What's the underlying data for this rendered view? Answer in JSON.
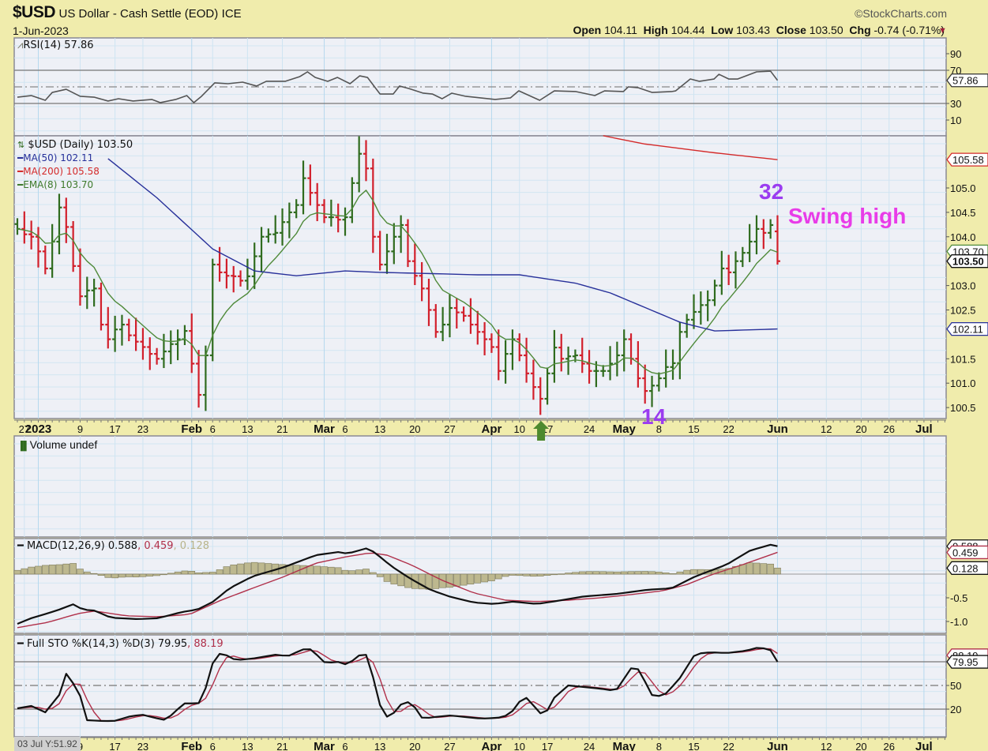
{
  "header": {
    "symbol": "$USD",
    "name": "US Dollar - Cash Settle (EOD)",
    "exchange": "ICE",
    "date": "1-Jun-2023",
    "brand": "©StockCharts.com",
    "open_label": "Open",
    "open": "104.11",
    "high_label": "High",
    "high": "104.44",
    "low_label": "Low",
    "low": "103.43",
    "close_label": "Close",
    "close": "103.50",
    "chg_label": "Chg",
    "chg": "-0.74 (-0.71%)",
    "chg_icon": "down-triangle-icon"
  },
  "legends": {
    "rsi": "RSI(14) 57.86",
    "price": "$USD (Daily) 103.50",
    "ma50": "MA(50) 102.11",
    "ma200": "MA(200) 105.58",
    "ema8": "EMA(8) 103.70",
    "volume": "Volume undef",
    "macd_main": "MACD(12,26,9) 0.588",
    "macd_signal": ", 0.459",
    "macd_hist": ", 0.128",
    "sto_main": "Full STO %K(14,3) %D(3) 79.95",
    "sto_d": ", 88.19"
  },
  "annotations": {
    "count_high": "32",
    "swing_high": "Swing high",
    "count_low": "14"
  },
  "footer": {
    "readout": "03 Jul Y:51.92"
  },
  "colors": {
    "up": "#2f6b1e",
    "down": "#d21f2b",
    "ma50": "#27309a",
    "ma200": "#d42a2a",
    "ema8": "#4f8a3a",
    "macd": "#111111",
    "signal": "#b0304a",
    "hist": "#bdb88f",
    "annot_purple": "#9b3cf0",
    "annot_magenta": "#e83ce8",
    "arrow": "#4d8a2e"
  },
  "chart_data": {
    "type": "bar",
    "title": "$USD US Dollar - Cash Settle (EOD) ICE",
    "last_bar": {
      "open": 104.11,
      "high": 104.44,
      "low": 103.43,
      "close": 103.5
    },
    "close": [
      104.16,
      104.05,
      104.0,
      103.7,
      103.35,
      103.9,
      104.6,
      104.2,
      103.4,
      102.78,
      102.9,
      102.94,
      102.2,
      101.9,
      102.1,
      102.2,
      101.98,
      101.85,
      101.74,
      101.6,
      101.5,
      101.65,
      101.8,
      101.9,
      102.07,
      101.4,
      100.76,
      101.57,
      103.43,
      103.27,
      103.2,
      103.19,
      103.1,
      103.19,
      103.6,
      104.0,
      104.05,
      104.08,
      104.3,
      104.5,
      104.65,
      105.2,
      104.9,
      104.65,
      104.4,
      104.4,
      104.35,
      104.4,
      105.1,
      105.7,
      105.4,
      104.0,
      103.43,
      103.7,
      104.0,
      104.24,
      103.5,
      103.2,
      102.94,
      102.5,
      102.05,
      102.2,
      102.54,
      102.45,
      102.38,
      102.2,
      102.05,
      101.9,
      101.74,
      101.25,
      101.6,
      101.9,
      101.57,
      101.2,
      100.92,
      100.68,
      101.2,
      101.73,
      101.5,
      101.55,
      101.57,
      101.4,
      101.25,
      101.25,
      101.25,
      101.4,
      101.57,
      101.9,
      101.5,
      101.1,
      100.84,
      100.95,
      101.1,
      101.33,
      101.41,
      102.05,
      102.3,
      102.46,
      102.6,
      102.7,
      103.0,
      103.35,
      103.27,
      103.5,
      103.67,
      103.9,
      104.16,
      104.08,
      104.24,
      103.5
    ],
    "ma50": [
      [
        13,
        105.6
      ],
      [
        20,
        104.8
      ],
      [
        28,
        103.75
      ],
      [
        34,
        103.3
      ],
      [
        40,
        103.2
      ],
      [
        47,
        103.3
      ],
      [
        52,
        103.27
      ],
      [
        58,
        103.25
      ],
      [
        66,
        103.22
      ],
      [
        72,
        103.22
      ],
      [
        80,
        103.05
      ],
      [
        85,
        102.85
      ],
      [
        90,
        102.55
      ],
      [
        95,
        102.25
      ],
      [
        100,
        102.07
      ],
      [
        109,
        102.11
      ]
    ],
    "ma200": [
      [
        84,
        106.07
      ],
      [
        90,
        105.9
      ],
      [
        100,
        105.72
      ],
      [
        109,
        105.58
      ]
    ],
    "ema_period": 8,
    "price_axis": {
      "ticks": [
        "105.0",
        "104.5",
        "104.0",
        "103.0",
        "102.5",
        "101.5",
        "101.0",
        "100.5"
      ],
      "range": [
        100.3,
        106.07
      ]
    },
    "price_tags": [
      {
        "value": 105.58,
        "label": "105.58",
        "color": "#d42a2a"
      },
      {
        "value": 103.7,
        "label": "103.70",
        "color": "#4f8a3a"
      },
      {
        "value": 103.5,
        "label": "103.50",
        "color": "#111111",
        "bold": true
      },
      {
        "value": 102.11,
        "label": "102.11",
        "color": "#27309a"
      }
    ],
    "date_axis": [
      {
        "bar": 1,
        "label": "27"
      },
      {
        "bar": 3,
        "label": "2023",
        "bold": true
      },
      {
        "bar": 9,
        "label": "9"
      },
      {
        "bar": 14,
        "label": "17"
      },
      {
        "bar": 18,
        "label": "23"
      },
      {
        "bar": 25,
        "label": "Feb",
        "bold": true
      },
      {
        "bar": 28,
        "label": "6"
      },
      {
        "bar": 33,
        "label": "13"
      },
      {
        "bar": 38,
        "label": "21"
      },
      {
        "bar": 44,
        "label": "Mar",
        "bold": true
      },
      {
        "bar": 47,
        "label": "6"
      },
      {
        "bar": 52,
        "label": "13"
      },
      {
        "bar": 57,
        "label": "20"
      },
      {
        "bar": 62,
        "label": "27"
      },
      {
        "bar": 68,
        "label": "Apr",
        "bold": true
      },
      {
        "bar": 72,
        "label": "10"
      },
      {
        "bar": 76,
        "label": "17"
      },
      {
        "bar": 82,
        "label": "24"
      },
      {
        "bar": 87,
        "label": "May",
        "bold": true
      },
      {
        "bar": 92,
        "label": "8"
      },
      {
        "bar": 97,
        "label": "15"
      },
      {
        "bar": 102,
        "label": "22"
      },
      {
        "bar": 109,
        "label": "Jun",
        "bold": true
      },
      {
        "bar": 116,
        "label": "12"
      },
      {
        "bar": 121,
        "label": "20"
      },
      {
        "bar": 125,
        "label": "26"
      },
      {
        "bar": 130,
        "label": "Jul",
        "bold": true
      }
    ],
    "rsi": {
      "points": [
        [
          0,
          37.6
        ],
        [
          2,
          39.5
        ],
        [
          4,
          33.8
        ],
        [
          5,
          43.3
        ],
        [
          7,
          47.1
        ],
        [
          9,
          38.6
        ],
        [
          11,
          37.6
        ],
        [
          13,
          32.9
        ],
        [
          14.5,
          35.7
        ],
        [
          16.6,
          32.9
        ],
        [
          19.3,
          34.8
        ],
        [
          20.5,
          31
        ],
        [
          22.7,
          34.8
        ],
        [
          24.3,
          39.5
        ],
        [
          25.3,
          31
        ],
        [
          26.4,
          38.6
        ],
        [
          28.3,
          54.8
        ],
        [
          30.2,
          53.8
        ],
        [
          32.3,
          55.7
        ],
        [
          34.3,
          51
        ],
        [
          35.7,
          56.7
        ],
        [
          38.4,
          56.7
        ],
        [
          40.5,
          62.4
        ],
        [
          41.6,
          68.1
        ],
        [
          42.7,
          61.4
        ],
        [
          44.5,
          56.7
        ],
        [
          45.9,
          61.4
        ],
        [
          47.7,
          53.8
        ],
        [
          49.1,
          63.3
        ],
        [
          50.2,
          61.4
        ],
        [
          52,
          41.4
        ],
        [
          53.9,
          41.4
        ],
        [
          54.8,
          51
        ],
        [
          56.1,
          48.1
        ],
        [
          58.2,
          42.4
        ],
        [
          59.5,
          41.4
        ],
        [
          60.9,
          35.7
        ],
        [
          62.3,
          42.4
        ],
        [
          64.3,
          38.6
        ],
        [
          66.4,
          36.7
        ],
        [
          68.5,
          34.8
        ],
        [
          70.7,
          36.7
        ],
        [
          71.9,
          45.2
        ],
        [
          74.9,
          33.8
        ],
        [
          77,
          45.2
        ],
        [
          80.1,
          44.3
        ],
        [
          82.8,
          39.5
        ],
        [
          84.2,
          45.2
        ],
        [
          86.9,
          44.3
        ],
        [
          87.6,
          50
        ],
        [
          89,
          49
        ],
        [
          91,
          43.3
        ],
        [
          93.8,
          44.3
        ],
        [
          94.4,
          45.2
        ],
        [
          96.5,
          59.5
        ],
        [
          97.8,
          56.7
        ],
        [
          99.9,
          59.5
        ],
        [
          100.6,
          65.2
        ],
        [
          102,
          59.5
        ],
        [
          103.3,
          59.5
        ],
        [
          106,
          68.1
        ],
        [
          108,
          69
        ],
        [
          109,
          57.86
        ]
      ],
      "ticks": [
        "90",
        "70",
        "30",
        "10"
      ],
      "levels": [
        70,
        50,
        30
      ],
      "tag": "57.86",
      "value": 57.86
    },
    "macd": {
      "macd": [
        [
          0,
          -1.05
        ],
        [
          2,
          -0.93
        ],
        [
          4.3,
          -0.83
        ],
        [
          6.6,
          -0.72
        ],
        [
          7.9,
          -0.63
        ],
        [
          9.4,
          -0.75
        ],
        [
          11.1,
          -0.77
        ],
        [
          13.4,
          -0.92
        ],
        [
          17.3,
          -0.95
        ],
        [
          20.2,
          -0.93
        ],
        [
          23.6,
          -0.8
        ],
        [
          25.8,
          -0.75
        ],
        [
          28.1,
          -0.58
        ],
        [
          30.4,
          -0.3
        ],
        [
          33.7,
          -0.05
        ],
        [
          38.3,
          0.15
        ],
        [
          42.8,
          0.4
        ],
        [
          46.2,
          0.47
        ],
        [
          47.3,
          0.43
        ],
        [
          49,
          0.5
        ],
        [
          50.2,
          0.55
        ],
        [
          51.3,
          0.45
        ],
        [
          53.6,
          0.17
        ],
        [
          56.4,
          -0.1
        ],
        [
          59.2,
          -0.33
        ],
        [
          62.1,
          -0.48
        ],
        [
          65.5,
          -0.6
        ],
        [
          68.3,
          -0.63
        ],
        [
          71.1,
          -0.58
        ],
        [
          74.5,
          -0.63
        ],
        [
          76.8,
          -0.58
        ],
        [
          81.3,
          -0.47
        ],
        [
          85.8,
          -0.42
        ],
        [
          90.4,
          -0.33
        ],
        [
          93.8,
          -0.3
        ],
        [
          97.2,
          -0.05
        ],
        [
          101.7,
          0.2
        ],
        [
          105.1,
          0.5
        ],
        [
          108,
          0.62
        ],
        [
          109,
          0.588
        ]
      ],
      "signal": [
        [
          0,
          -1.13
        ],
        [
          4.3,
          -1.02
        ],
        [
          8.8,
          -0.83
        ],
        [
          11.1,
          -0.78
        ],
        [
          15.6,
          -0.88
        ],
        [
          20.2,
          -0.9
        ],
        [
          24.7,
          -0.85
        ],
        [
          29.2,
          -0.55
        ],
        [
          33.7,
          -0.3
        ],
        [
          38.3,
          -0.05
        ],
        [
          42.8,
          0.23
        ],
        [
          47.3,
          0.37
        ],
        [
          50.7,
          0.45
        ],
        [
          53,
          0.4
        ],
        [
          56.4,
          0.2
        ],
        [
          60.9,
          -0.13
        ],
        [
          65.5,
          -0.4
        ],
        [
          70,
          -0.55
        ],
        [
          74.5,
          -0.58
        ],
        [
          79,
          -0.55
        ],
        [
          83.6,
          -0.5
        ],
        [
          88.1,
          -0.43
        ],
        [
          92.6,
          -0.35
        ],
        [
          96,
          -0.22
        ],
        [
          99.4,
          -0.02
        ],
        [
          104,
          0.2
        ],
        [
          109,
          0.459
        ]
      ],
      "ticks": [
        "-0.5",
        "-1.0"
      ],
      "tags": [
        {
          "value": 0.588,
          "label": "0.588",
          "color": "#111111"
        },
        {
          "value": 0.459,
          "label": "0.459",
          "color": "#b0304a"
        },
        {
          "value": 0.128,
          "label": "0.128",
          "color": "#111111"
        }
      ]
    },
    "stochastic": {
      "k": [
        [
          0,
          21
        ],
        [
          2,
          24
        ],
        [
          4,
          16
        ],
        [
          6,
          38
        ],
        [
          6.9,
          66
        ],
        [
          8.8,
          43
        ],
        [
          10,
          6
        ],
        [
          12.2,
          5
        ],
        [
          13.9,
          5
        ],
        [
          16.2,
          11
        ],
        [
          17.9,
          13
        ],
        [
          20.2,
          8
        ],
        [
          21.3,
          6
        ],
        [
          23,
          20
        ],
        [
          24.1,
          28
        ],
        [
          25.3,
          27
        ],
        [
          26.4,
          28
        ],
        [
          28.1,
          81
        ],
        [
          29.2,
          92
        ],
        [
          31.3,
          82
        ],
        [
          33.7,
          84
        ],
        [
          37.1,
          89
        ],
        [
          38.8,
          87
        ],
        [
          40.5,
          94
        ],
        [
          41.7,
          98
        ],
        [
          42.8,
          90
        ],
        [
          44.3,
          77
        ],
        [
          45.6,
          81
        ],
        [
          47.3,
          76
        ],
        [
          49,
          88
        ],
        [
          50.2,
          89
        ],
        [
          52.4,
          11
        ],
        [
          53.6,
          10
        ],
        [
          54.7,
          25
        ],
        [
          56.4,
          30
        ],
        [
          58.1,
          8
        ],
        [
          59.8,
          10
        ],
        [
          62.1,
          12
        ],
        [
          64.3,
          10
        ],
        [
          66.6,
          8
        ],
        [
          68.9,
          9
        ],
        [
          70.6,
          13
        ],
        [
          72.3,
          33
        ],
        [
          73.4,
          35
        ],
        [
          74.5,
          16
        ],
        [
          75.7,
          13
        ],
        [
          76.8,
          33
        ],
        [
          79,
          50
        ],
        [
          81.3,
          48
        ],
        [
          83.6,
          46
        ],
        [
          85.8,
          43
        ],
        [
          88.1,
          73
        ],
        [
          89.2,
          70
        ],
        [
          90.9,
          38
        ],
        [
          92.6,
          36
        ],
        [
          94.9,
          58
        ],
        [
          97.2,
          90
        ],
        [
          99.4,
          92
        ],
        [
          101.7,
          91
        ],
        [
          104.5,
          94
        ],
        [
          106.2,
          98
        ],
        [
          107.9,
          96
        ],
        [
          109,
          79.95
        ]
      ],
      "d_period": 3,
      "ticks": [
        "50",
        "20"
      ],
      "levels": [
        80,
        50,
        20
      ],
      "tags": [
        {
          "value": 88.19,
          "label": "88.19",
          "color": "#b0304a"
        },
        {
          "value": 79.95,
          "label": "79.95",
          "color": "#111111"
        }
      ]
    }
  }
}
